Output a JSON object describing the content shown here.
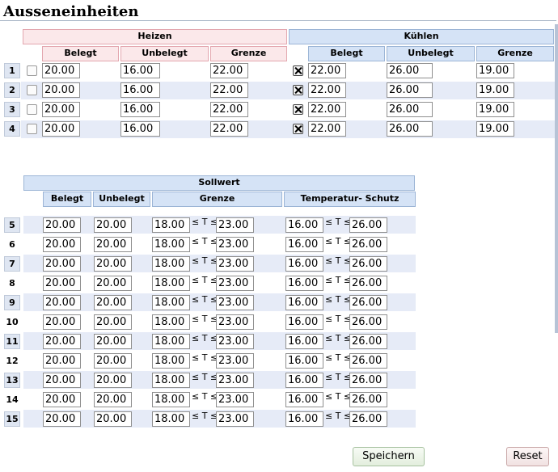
{
  "page": {
    "title": "Ausseneinheiten"
  },
  "top_section": {
    "heat_title": "Heizen",
    "cool_title": "Kühlen",
    "heat_columns": [
      "Belegt",
      "Unbelegt",
      "Grenze"
    ],
    "cool_columns": [
      "Belegt",
      "Unbelegt",
      "Grenze"
    ],
    "rows": [
      {
        "index": "1",
        "heat_enabled": false,
        "heat": [
          "20.00",
          "16.00",
          "22.00"
        ],
        "cool_enabled": true,
        "cool": [
          "22.00",
          "26.00",
          "19.00"
        ]
      },
      {
        "index": "2",
        "heat_enabled": false,
        "heat": [
          "20.00",
          "16.00",
          "22.00"
        ],
        "cool_enabled": true,
        "cool": [
          "22.00",
          "26.00",
          "19.00"
        ]
      },
      {
        "index": "3",
        "heat_enabled": false,
        "heat": [
          "20.00",
          "16.00",
          "22.00"
        ],
        "cool_enabled": true,
        "cool": [
          "22.00",
          "26.00",
          "19.00"
        ]
      },
      {
        "index": "4",
        "heat_enabled": false,
        "heat": [
          "20.00",
          "16.00",
          "22.00"
        ],
        "cool_enabled": true,
        "cool": [
          "22.00",
          "26.00",
          "19.00"
        ]
      }
    ]
  },
  "bottom_section": {
    "title": "Sollwert",
    "columns": [
      "Belegt",
      "Unbelegt",
      "Grenze",
      "Temperatur- Schutz"
    ],
    "range_symbol": "≤ T ≤",
    "rows": [
      {
        "index": "5",
        "belegt": "20.00",
        "unbelegt": "20.00",
        "grenze_min": "18.00",
        "grenze_max": "23.00",
        "schutz_min": "16.00",
        "schutz_max": "26.00"
      },
      {
        "index": "6",
        "belegt": "20.00",
        "unbelegt": "20.00",
        "grenze_min": "18.00",
        "grenze_max": "23.00",
        "schutz_min": "16.00",
        "schutz_max": "26.00"
      },
      {
        "index": "7",
        "belegt": "20.00",
        "unbelegt": "20.00",
        "grenze_min": "18.00",
        "grenze_max": "23.00",
        "schutz_min": "16.00",
        "schutz_max": "26.00"
      },
      {
        "index": "8",
        "belegt": "20.00",
        "unbelegt": "20.00",
        "grenze_min": "18.00",
        "grenze_max": "23.00",
        "schutz_min": "16.00",
        "schutz_max": "26.00"
      },
      {
        "index": "9",
        "belegt": "20.00",
        "unbelegt": "20.00",
        "grenze_min": "18.00",
        "grenze_max": "23.00",
        "schutz_min": "16.00",
        "schutz_max": "26.00"
      },
      {
        "index": "10",
        "belegt": "20.00",
        "unbelegt": "20.00",
        "grenze_min": "18.00",
        "grenze_max": "23.00",
        "schutz_min": "16.00",
        "schutz_max": "26.00"
      },
      {
        "index": "11",
        "belegt": "20.00",
        "unbelegt": "20.00",
        "grenze_min": "18.00",
        "grenze_max": "23.00",
        "schutz_min": "16.00",
        "schutz_max": "26.00"
      },
      {
        "index": "12",
        "belegt": "20.00",
        "unbelegt": "20.00",
        "grenze_min": "18.00",
        "grenze_max": "23.00",
        "schutz_min": "16.00",
        "schutz_max": "26.00"
      },
      {
        "index": "13",
        "belegt": "20.00",
        "unbelegt": "20.00",
        "grenze_min": "18.00",
        "grenze_max": "23.00",
        "schutz_min": "16.00",
        "schutz_max": "26.00"
      },
      {
        "index": "14",
        "belegt": "20.00",
        "unbelegt": "20.00",
        "grenze_min": "18.00",
        "grenze_max": "23.00",
        "schutz_min": "16.00",
        "schutz_max": "26.00"
      },
      {
        "index": "15",
        "belegt": "20.00",
        "unbelegt": "20.00",
        "grenze_min": "18.00",
        "grenze_max": "23.00",
        "schutz_min": "16.00",
        "schutz_max": "26.00"
      }
    ]
  },
  "actions": {
    "save_label": "Speichern",
    "reset_label": "Reset"
  }
}
